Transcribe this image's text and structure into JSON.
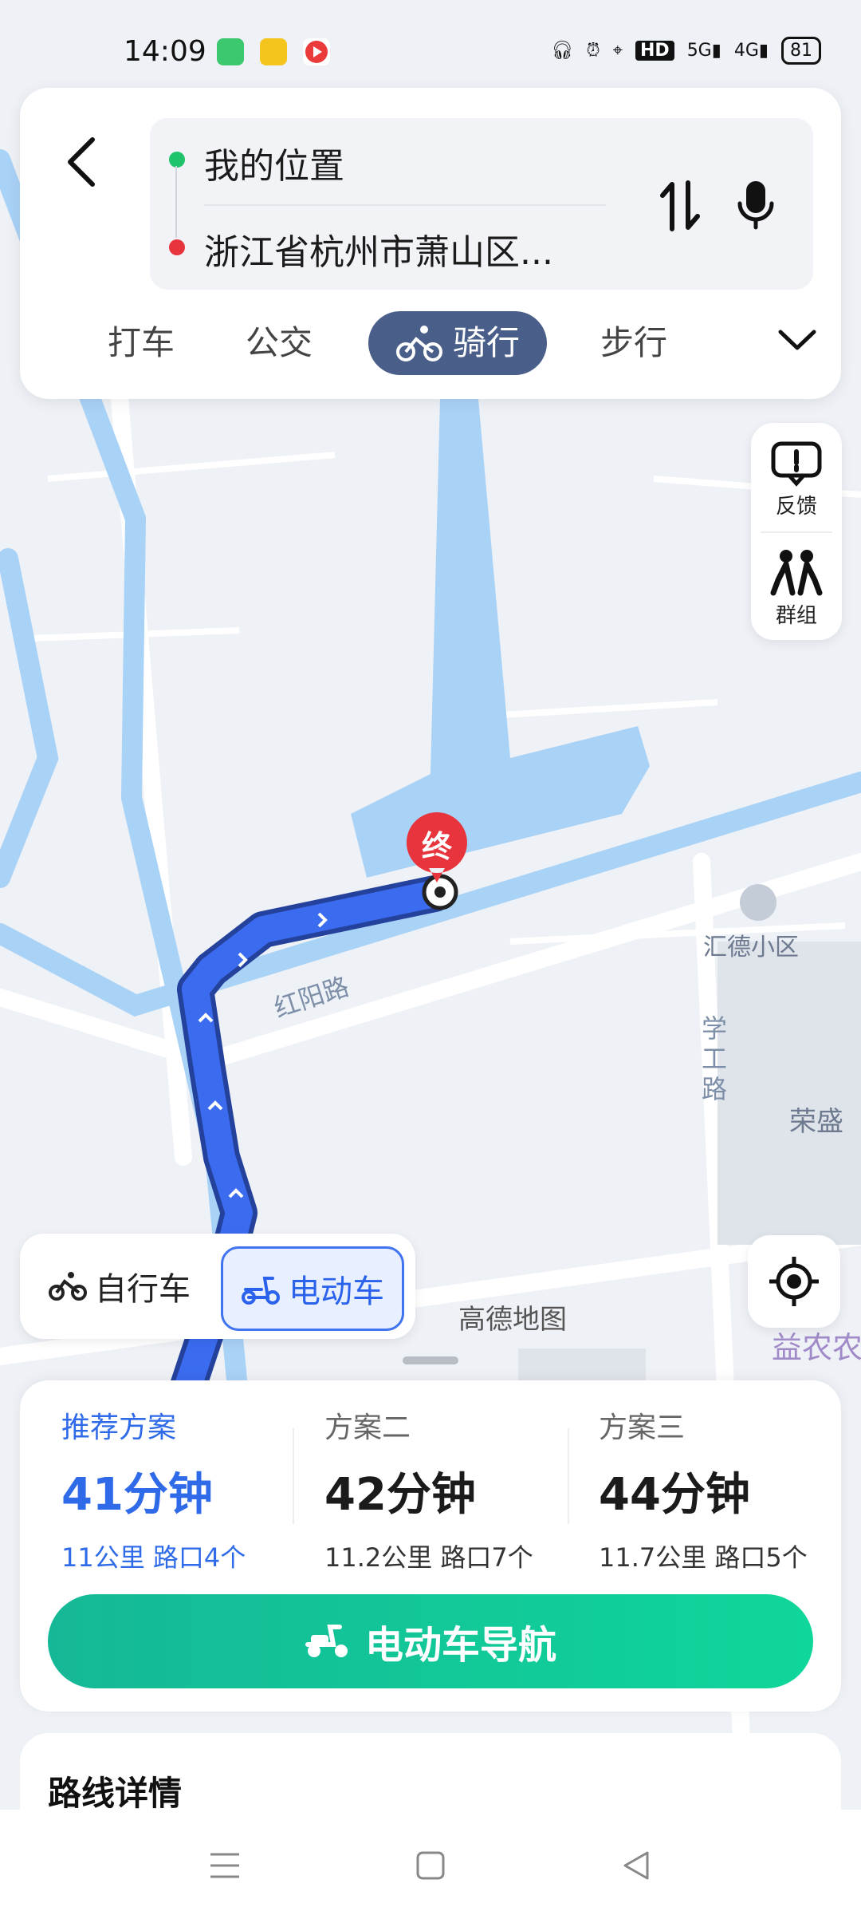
{
  "status_bar": {
    "time": "14:09",
    "network_5g": "5G",
    "network_4g": "4G",
    "hd_label": "HD",
    "battery": "81"
  },
  "search": {
    "origin": "我的位置",
    "destination": "浙江省杭州市萧山区..."
  },
  "modes": [
    {
      "label": "打车"
    },
    {
      "label": "公交"
    },
    {
      "label": "骑行"
    },
    {
      "label": "步行"
    }
  ],
  "side_tools": {
    "feedback": "反馈",
    "group": "群组"
  },
  "map": {
    "end_marker": "终",
    "road_hongyang": "红阳路",
    "road_xuegong": "学工路",
    "poi_huide": "汇德小区",
    "poi_rongsheng": "荣盛",
    "poi_yinong": "益农农",
    "credit": "高德地图"
  },
  "vehicle": {
    "bike": "自行车",
    "ebike": "电动车"
  },
  "plans": [
    {
      "label": "推荐方案",
      "time": "41分钟",
      "meta": "11公里  路口4个"
    },
    {
      "label": "方案二",
      "time": "42分钟",
      "meta": "11.2公里  路口7个"
    },
    {
      "label": "方案三",
      "time": "44分钟",
      "meta": "11.7公里  路口5个"
    }
  ],
  "nav_button": "电动车导航",
  "details_title": "路线详情",
  "colors": {
    "route": "#3b6cf0",
    "water": "#a9d2f7",
    "primary": "#2f6ae8",
    "nav_green": "#13c596",
    "mode_active": "#4a5e8a"
  }
}
